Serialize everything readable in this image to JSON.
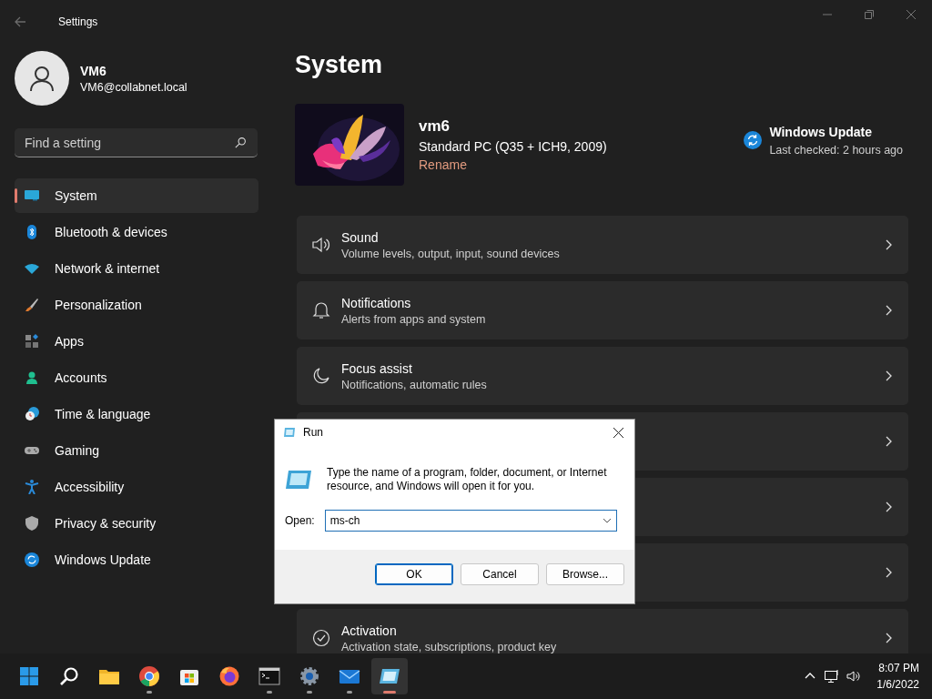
{
  "window": {
    "title": "Settings"
  },
  "profile": {
    "name": "VM6",
    "email": "VM6@collabnet.local"
  },
  "search": {
    "placeholder": "Find a setting"
  },
  "sidebar": {
    "items": [
      {
        "label": "System",
        "selected": true
      },
      {
        "label": "Bluetooth & devices",
        "selected": false
      },
      {
        "label": "Network & internet",
        "selected": false
      },
      {
        "label": "Personalization",
        "selected": false
      },
      {
        "label": "Apps",
        "selected": false
      },
      {
        "label": "Accounts",
        "selected": false
      },
      {
        "label": "Time & language",
        "selected": false
      },
      {
        "label": "Gaming",
        "selected": false
      },
      {
        "label": "Accessibility",
        "selected": false
      },
      {
        "label": "Privacy & security",
        "selected": false
      },
      {
        "label": "Windows Update",
        "selected": false
      }
    ]
  },
  "page": {
    "title": "System"
  },
  "device": {
    "name": "vm6",
    "model": "Standard PC (Q35 + ICH9, 2009)",
    "rename_link": "Rename"
  },
  "update": {
    "title": "Windows Update",
    "status": "Last checked: 2 hours ago"
  },
  "cards": [
    {
      "kind": "item",
      "title": "Sound",
      "subtitle": "Volume levels, output, input, sound devices"
    },
    {
      "kind": "item",
      "title": "Notifications",
      "subtitle": "Alerts from apps and system"
    },
    {
      "kind": "item",
      "title": "Focus assist",
      "subtitle": "Notifications, automatic rules"
    },
    {
      "kind": "covered"
    },
    {
      "kind": "covered"
    },
    {
      "kind": "covered"
    },
    {
      "kind": "item",
      "title": "Activation",
      "subtitle": "Activation state, subscriptions, product key"
    }
  ],
  "run_dialog": {
    "title": "Run",
    "description": "Type the name of a program, folder, document, or Internet resource, and Windows will open it for you.",
    "open_label": "Open:",
    "value": "ms-ch",
    "buttons": [
      {
        "label": "OK",
        "default": true
      },
      {
        "label": "Cancel",
        "default": false
      },
      {
        "label": "Browse...",
        "default": false
      }
    ]
  },
  "taskbar": {
    "apps": [
      {
        "running": false,
        "selected": false
      },
      {
        "running": false,
        "selected": false
      },
      {
        "running": false,
        "selected": false
      },
      {
        "running": true,
        "selected": false
      },
      {
        "running": false,
        "selected": false
      },
      {
        "running": false,
        "selected": false
      },
      {
        "running": true,
        "selected": false
      },
      {
        "running": true,
        "selected": false
      },
      {
        "running": true,
        "selected": false
      },
      {
        "running": true,
        "selected": true
      }
    ],
    "time": "8:07 PM",
    "date": "1/6/2022"
  }
}
